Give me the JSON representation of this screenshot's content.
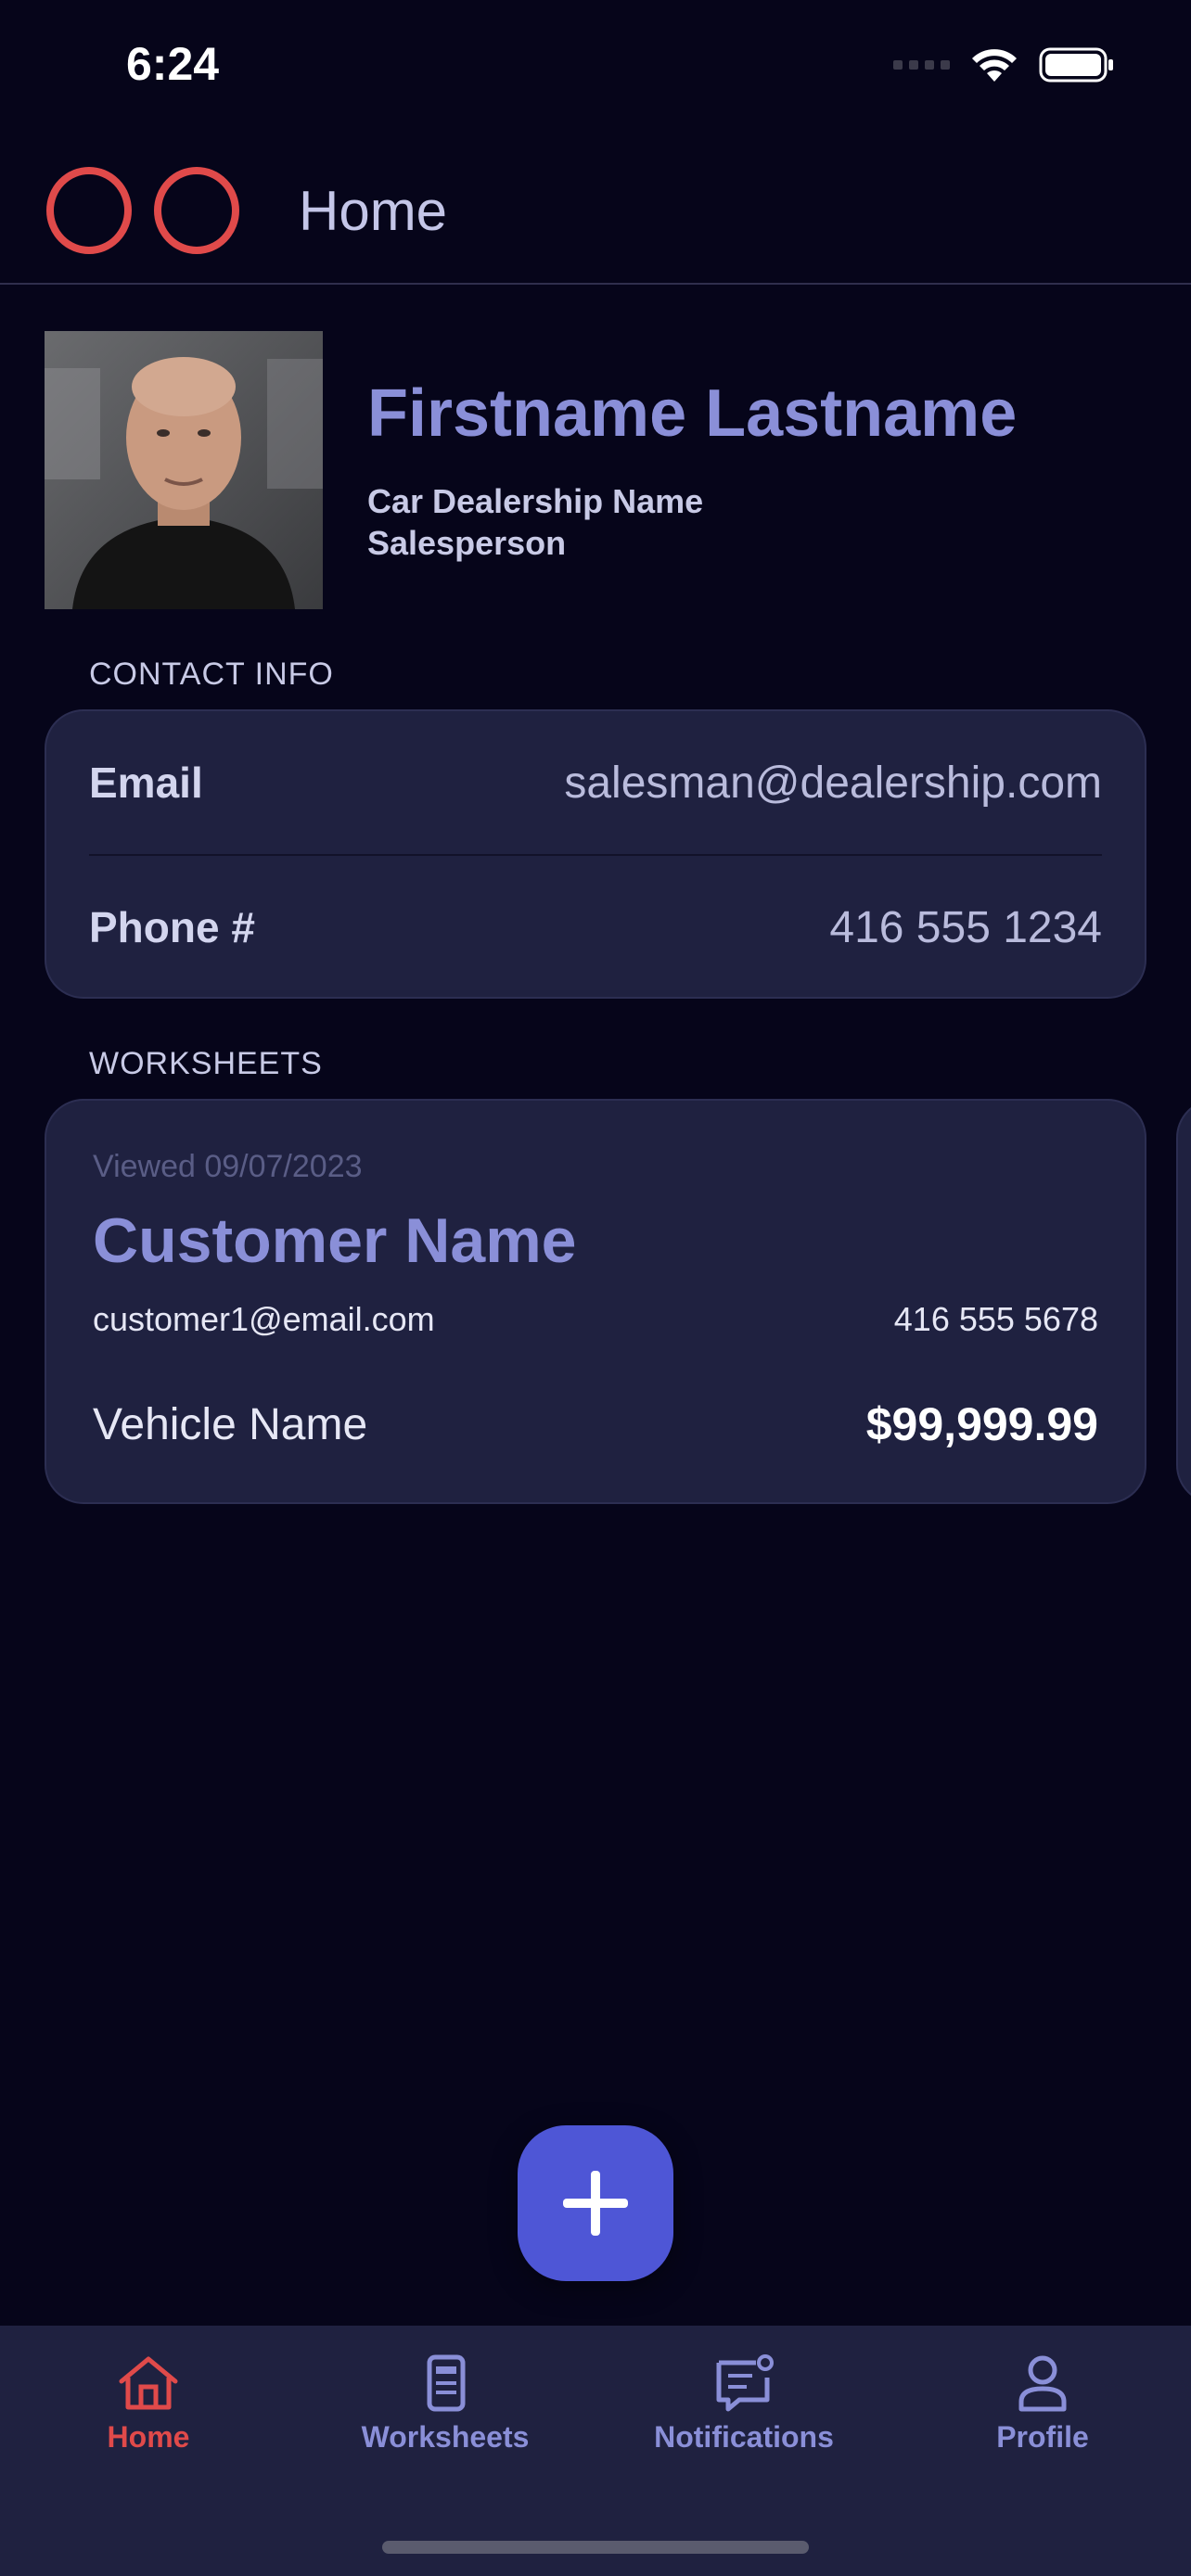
{
  "status_bar": {
    "time": "6:24"
  },
  "header": {
    "title": "Home"
  },
  "profile": {
    "name": "Firstname Lastname",
    "dealership": "Car Dealership Name",
    "role": "Salesperson"
  },
  "contact": {
    "section_label": "CONTACT INFO",
    "email_label": "Email",
    "email_value": "salesman@dealership.com",
    "phone_label": "Phone #",
    "phone_value": "416 555 1234"
  },
  "worksheets": {
    "section_label": "WORKSHEETS",
    "items": [
      {
        "viewed": "Viewed 09/07/2023",
        "customer_name": "Customer Name",
        "customer_email": "customer1@email.com",
        "customer_phone": "416 555 5678",
        "vehicle": "Vehicle Name",
        "price": "$99,999.99"
      }
    ]
  },
  "fab": {
    "icon": "plus-icon"
  },
  "nav": {
    "items": [
      {
        "label": "Home",
        "icon": "home-icon",
        "active": true
      },
      {
        "label": "Worksheets",
        "icon": "document-icon",
        "active": false
      },
      {
        "label": "Notifications",
        "icon": "notification-icon",
        "active": false
      },
      {
        "label": "Profile",
        "icon": "person-icon",
        "active": false
      }
    ]
  },
  "colors": {
    "background": "#06051a",
    "card": "#1f2140",
    "accent": "#8a8fd8",
    "brand_red": "#e04a4a",
    "fab": "#4e56d6"
  }
}
